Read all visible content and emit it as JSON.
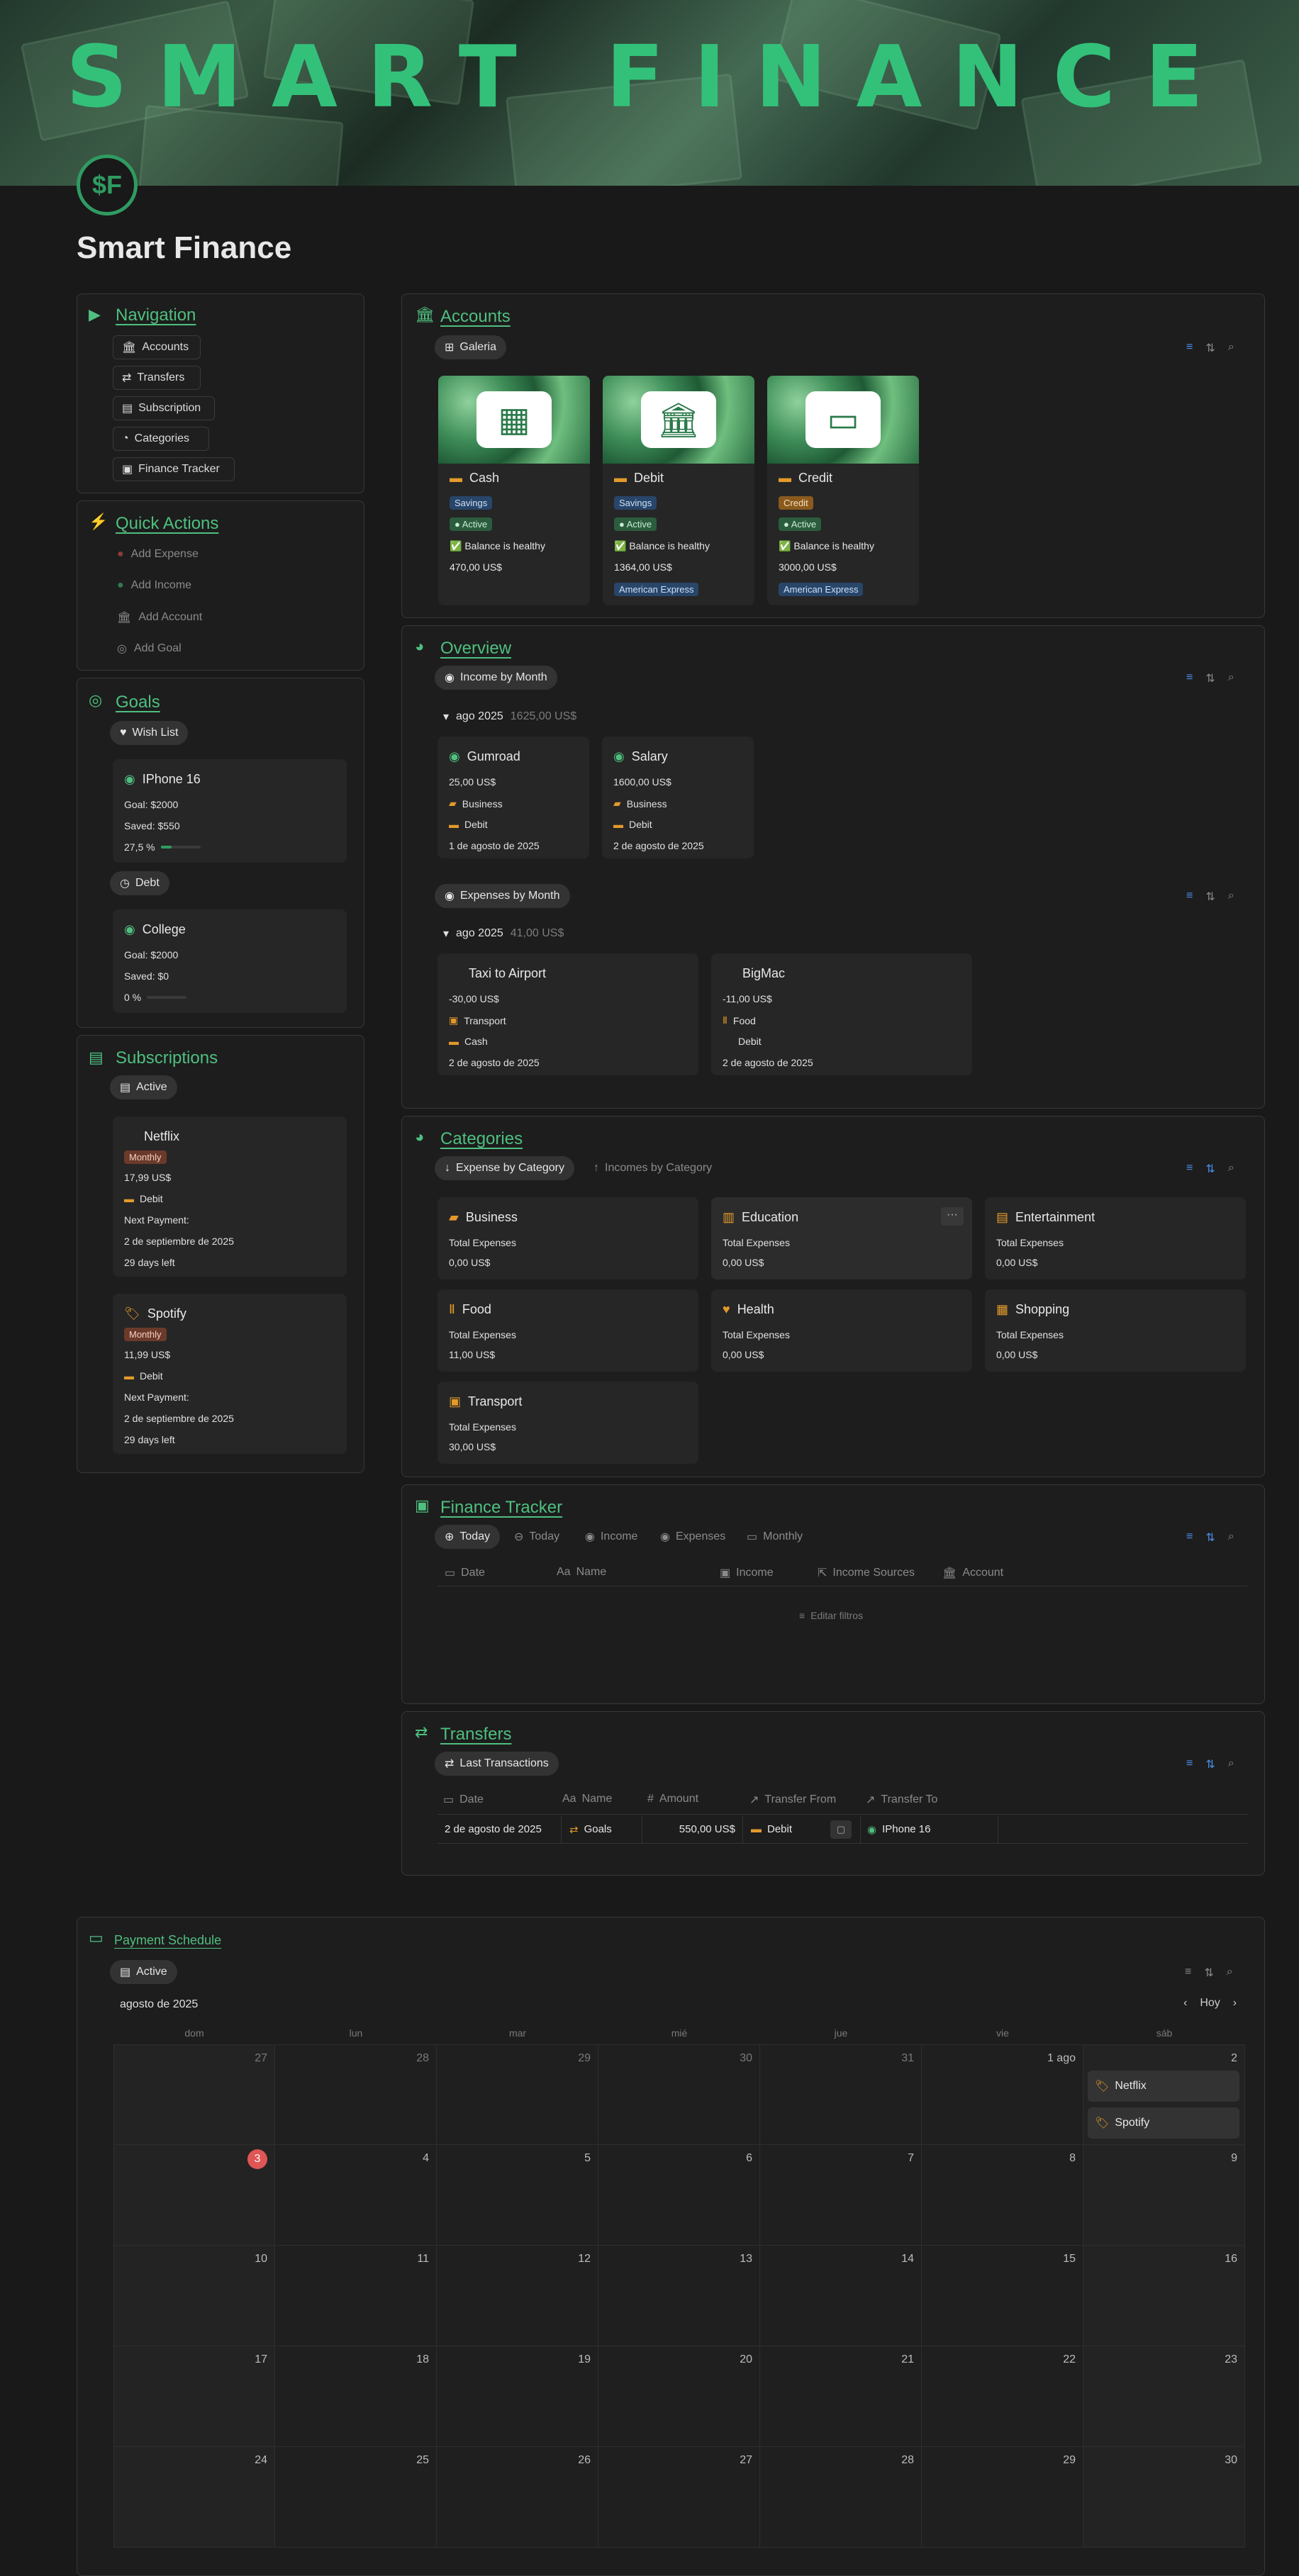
{
  "banner": {
    "title": "SMART FINANCE",
    "logo_text": "$F"
  },
  "page_title": "Smart Finance",
  "navigation": {
    "title": "Navigation",
    "items": [
      "Accounts",
      "Transfers",
      "Subscription",
      "Categories",
      "Finance Tracker"
    ]
  },
  "quick_actions": {
    "title": "Quick Actions",
    "items": [
      "Add Expense",
      "Add Income",
      "Add Account",
      "Add Goal"
    ]
  },
  "goals": {
    "title": "Goals",
    "groups": [
      {
        "label": "Wish List",
        "name": "IPhone 16",
        "goal": "Goal: $2000",
        "saved": "Saved: $550",
        "pct": "27,5 %",
        "progress": 0.275
      },
      {
        "label": "Debt",
        "name": "College",
        "goal": "Goal: $2000",
        "saved": "Saved: $0",
        "pct": "0 %",
        "progress": 0
      }
    ]
  },
  "subscriptions": {
    "title": "Subscriptions",
    "filter": "Active",
    "items": [
      {
        "name": "Netflix",
        "freq": "Monthly",
        "price": "17,99 US$",
        "account": "Debit",
        "next_label": "Next Payment:",
        "next_date": "2 de septiembre de 2025",
        "left": "29 days left"
      },
      {
        "name": "Spotify",
        "freq": "Monthly",
        "price": "11,99 US$",
        "account": "Debit",
        "next_label": "Next Payment:",
        "next_date": "2 de septiembre de 2025",
        "left": "29 days left"
      }
    ]
  },
  "accounts": {
    "title": "Accounts",
    "view": "Galeria",
    "items": [
      {
        "name": "Cash",
        "type": "Savings",
        "status": "Active",
        "health": "Balance is healthy",
        "balance": "470,00 US$",
        "bank": ""
      },
      {
        "name": "Debit",
        "type": "Savings",
        "status": "Active",
        "health": "Balance is healthy",
        "balance": "1364,00 US$",
        "bank": "American Express"
      },
      {
        "name": "Credit",
        "type": "Credit",
        "status": "Active",
        "health": "Balance is healthy",
        "balance": "3000,00 US$",
        "bank": "American Express"
      }
    ]
  },
  "overview": {
    "title": "Overview",
    "income": {
      "view": "Income by Month",
      "group": "ago 2025",
      "total": "1625,00 US$",
      "items": [
        {
          "name": "Gumroad",
          "amount": "25,00 US$",
          "category": "Business",
          "account": "Debit",
          "date": "1 de agosto de 2025"
        },
        {
          "name": "Salary",
          "amount": "1600,00 US$",
          "category": "Business",
          "account": "Debit",
          "date": "2 de agosto de 2025"
        }
      ]
    },
    "expenses": {
      "view": "Expenses by Month",
      "group": "ago 2025",
      "total": "41,00 US$",
      "items": [
        {
          "name": "Taxi to Airport",
          "amount": "-30,00 US$",
          "category": "Transport",
          "account": "Cash",
          "date": "2 de agosto de 2025"
        },
        {
          "name": "BigMac",
          "amount": "-11,00 US$",
          "category": "Food",
          "account": "Debit",
          "date": "2 de agosto de 2025"
        }
      ]
    }
  },
  "categories": {
    "title": "Categories",
    "views": [
      "Expense by Category",
      "Incomes by Category"
    ],
    "label": "Total Expenses",
    "items": [
      {
        "name": "Business",
        "value": "0,00 US$"
      },
      {
        "name": "Education",
        "value": "0,00 US$"
      },
      {
        "name": "Entertainment",
        "value": "0,00 US$"
      },
      {
        "name": "Food",
        "value": "11,00 US$"
      },
      {
        "name": "Health",
        "value": "0,00 US$"
      },
      {
        "name": "Shopping",
        "value": "0,00 US$"
      },
      {
        "name": "Transport",
        "value": "30,00 US$"
      }
    ]
  },
  "finance_tracker": {
    "title": "Finance Tracker",
    "views": [
      "Today",
      "Today",
      "Income",
      "Expenses",
      "Monthly"
    ],
    "columns": [
      "Date",
      "Name",
      "Income",
      "Income Sources",
      "Account"
    ],
    "empty": "Editar filtros"
  },
  "transfers": {
    "title": "Transfers",
    "view": "Last Transactions",
    "columns": [
      "Date",
      "Name",
      "Amount",
      "Transfer From",
      "Transfer To"
    ],
    "row": {
      "date": "2 de agosto de 2025",
      "name": "Goals",
      "amount": "550,00 US$",
      "from": "Debit",
      "to": "IPhone 16"
    }
  },
  "payment_schedule": {
    "title": "Payment Schedule",
    "filter": "Active",
    "month": "agosto de 2025",
    "today_btn": "Hoy",
    "days": [
      "dom",
      "lun",
      "mar",
      "mié",
      "jue",
      "vie",
      "sáb"
    ],
    "weeks": [
      [
        "27",
        "28",
        "29",
        "30",
        "31",
        "1 ago",
        "2"
      ],
      [
        "3",
        "4",
        "5",
        "6",
        "7",
        "8",
        "9"
      ],
      [
        "10",
        "11",
        "12",
        "13",
        "14",
        "15",
        "16"
      ],
      [
        "17",
        "18",
        "19",
        "20",
        "21",
        "22",
        "23"
      ],
      [
        "24",
        "25",
        "26",
        "27",
        "28",
        "29",
        "30"
      ]
    ],
    "events": [
      "Netflix",
      "Spotify"
    ]
  }
}
